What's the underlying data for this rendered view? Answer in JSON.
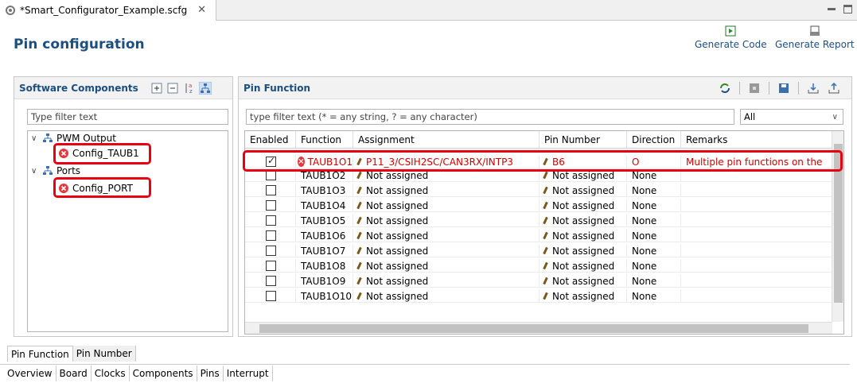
{
  "editor_tab": {
    "title": "*Smart_Configurator_Example.scfg",
    "close": "✕"
  },
  "header": {
    "title": "Pin configuration",
    "generate_code": "Generate Code",
    "generate_report": "Generate Report"
  },
  "left_panel": {
    "title": "Software Components",
    "filter_placeholder": "Type filter text",
    "tree": [
      {
        "label": "PWM Output",
        "children": [
          "Config_TAUB1"
        ]
      },
      {
        "label": "Ports",
        "children": [
          "Config_PORT"
        ]
      }
    ]
  },
  "right_panel": {
    "title": "Pin Function",
    "filter_placeholder": "type filter text (* = any string, ? = any character)",
    "filter_select": "All",
    "columns": [
      "Enabled",
      "Function",
      "Assignment",
      "Pin Number",
      "Direction",
      "Remarks"
    ],
    "rows": [
      {
        "enabled": true,
        "function": "TAUB1O1",
        "assignment": "P11_3/CSIH2SC/CAN3RX/INTP3",
        "pin": "B6",
        "direction": "O",
        "remarks": "Multiple pin functions on the",
        "error": true
      },
      {
        "enabled": false,
        "function": "TAUB1O2",
        "assignment": "Not assigned",
        "pin": "Not assigned",
        "direction": "None",
        "remarks": ""
      },
      {
        "enabled": false,
        "function": "TAUB1O3",
        "assignment": "Not assigned",
        "pin": "Not assigned",
        "direction": "None",
        "remarks": ""
      },
      {
        "enabled": false,
        "function": "TAUB1O4",
        "assignment": "Not assigned",
        "pin": "Not assigned",
        "direction": "None",
        "remarks": ""
      },
      {
        "enabled": false,
        "function": "TAUB1O5",
        "assignment": "Not assigned",
        "pin": "Not assigned",
        "direction": "None",
        "remarks": ""
      },
      {
        "enabled": false,
        "function": "TAUB1O6",
        "assignment": "Not assigned",
        "pin": "Not assigned",
        "direction": "None",
        "remarks": ""
      },
      {
        "enabled": false,
        "function": "TAUB1O7",
        "assignment": "Not assigned",
        "pin": "Not assigned",
        "direction": "None",
        "remarks": ""
      },
      {
        "enabled": false,
        "function": "TAUB1O8",
        "assignment": "Not assigned",
        "pin": "Not assigned",
        "direction": "None",
        "remarks": ""
      },
      {
        "enabled": false,
        "function": "TAUB1O9",
        "assignment": "Not assigned",
        "pin": "Not assigned",
        "direction": "None",
        "remarks": ""
      },
      {
        "enabled": false,
        "function": "TAUB1O10",
        "assignment": "Not assigned",
        "pin": "Not assigned",
        "direction": "None",
        "remarks": ""
      }
    ]
  },
  "view_tabs": [
    "Pin Function",
    "Pin Number"
  ],
  "page_tabs": [
    "Overview",
    "Board",
    "Clocks",
    "Components",
    "Pins",
    "Interrupt"
  ],
  "active_page_tab": "Pins",
  "colors": {
    "accent": "#1c4e80",
    "error": "#d00000",
    "highlight_box": "#e60012"
  }
}
